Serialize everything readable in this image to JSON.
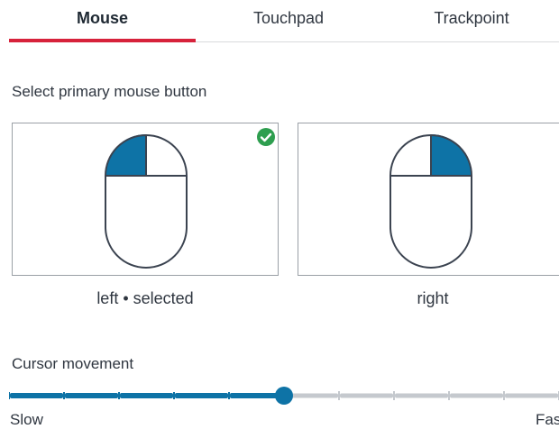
{
  "tabs": [
    {
      "label": "Mouse",
      "active": true
    },
    {
      "label": "Touchpad",
      "active": false
    },
    {
      "label": "Trackpoint",
      "active": false
    }
  ],
  "primary_button": {
    "label": "Select primary mouse button",
    "options": [
      {
        "caption": "left • selected",
        "selected": true
      },
      {
        "caption": "right",
        "selected": false
      }
    ]
  },
  "cursor_movement": {
    "label": "Cursor movement",
    "min_label": "Slow",
    "max_label": "Fast",
    "steps": 10,
    "value_step": 5
  },
  "colors": {
    "accent": "#0e73a6",
    "tab_indicator": "#d7223b",
    "check": "#2e9e4f",
    "track_inactive": "#c5c9ce"
  }
}
